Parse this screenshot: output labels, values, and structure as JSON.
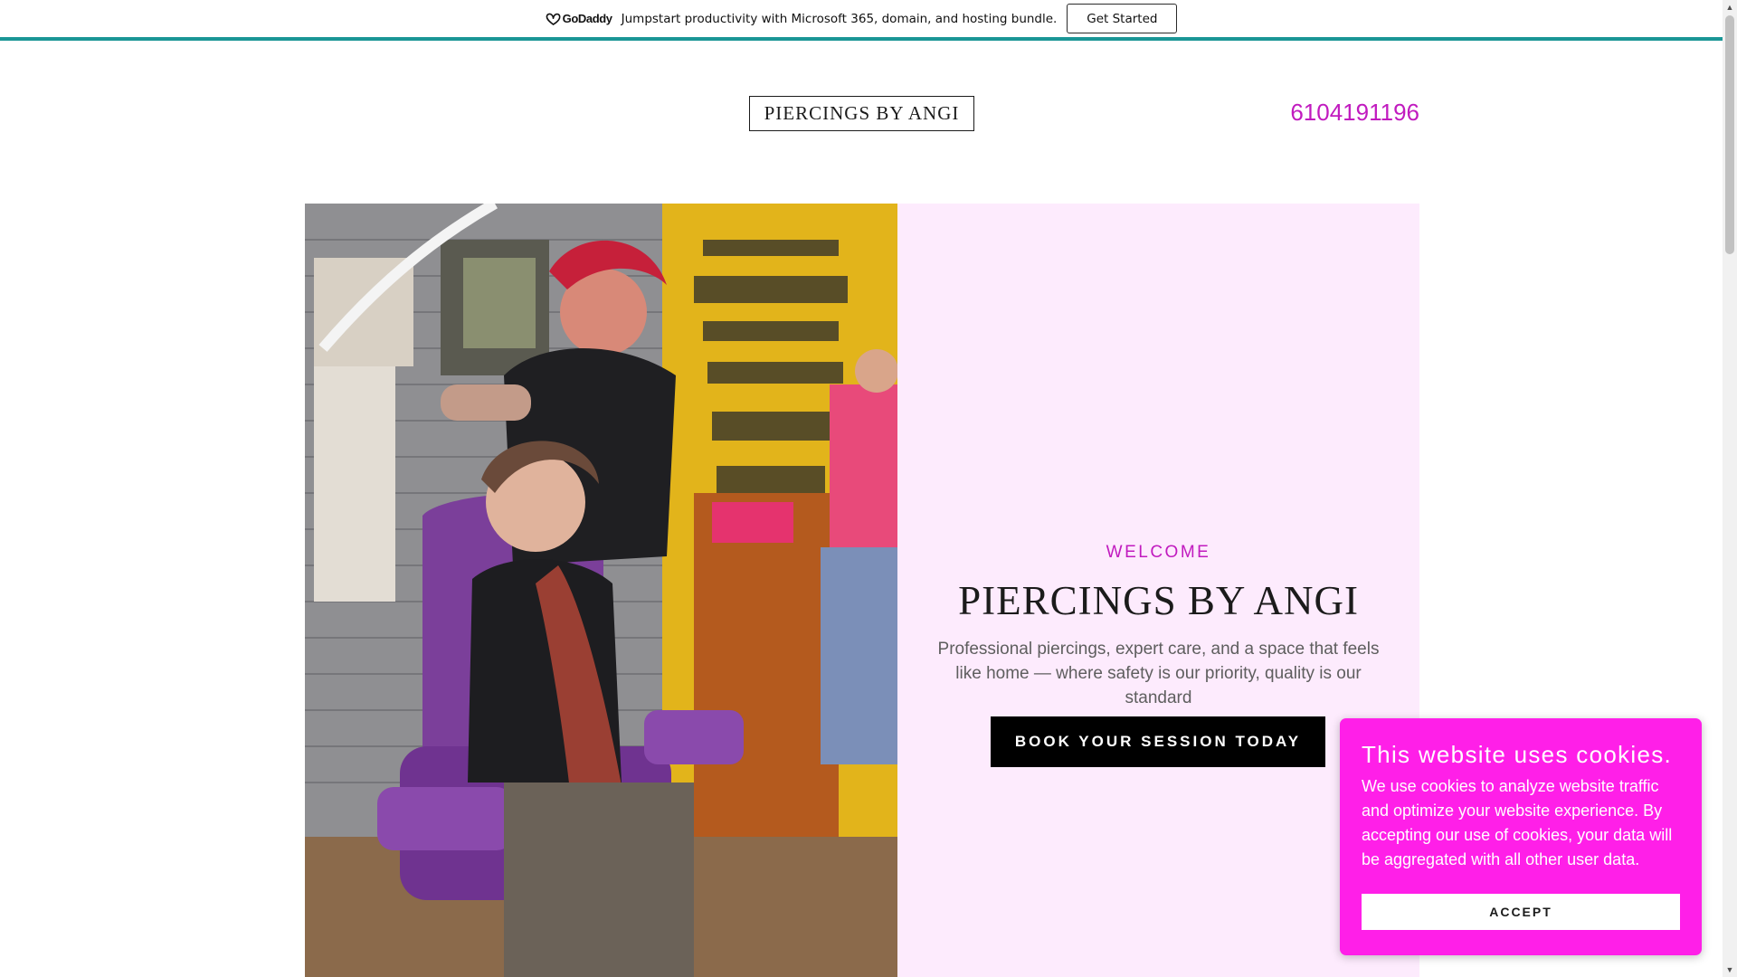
{
  "promo": {
    "logo_text": "GoDaddy",
    "message": "Jumpstart productivity with Microsoft 365, domain, and hosting bundle.",
    "cta_label": "Get Started",
    "accent_color": "#1a9696"
  },
  "header": {
    "logo_text": "PIERCINGS BY ANGI",
    "phone": "6104191196"
  },
  "hero": {
    "photo_icon": "hero-photo",
    "eyebrow": "WELCOME",
    "title": "PIERCINGS BY ANGI",
    "subtitle": "Professional piercings, expert care, and a space that feels like home — where safety is our priority, quality is our standard",
    "cta_label": "BOOK YOUR SESSION TODAY",
    "panel_color": "#fdebfd"
  },
  "cookie": {
    "title": "This website uses cookies.",
    "body": "We use cookies to analyze website traffic and optimize your website experience. By accepting our use of cookies, your data will be aggregated with all other user data.",
    "accept_label": "ACCEPT",
    "background_color": "#ff1fe8"
  },
  "theme": {
    "accent": "#c11bbf"
  }
}
